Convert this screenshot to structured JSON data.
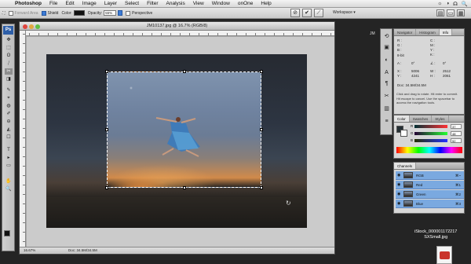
{
  "menubar": {
    "apple": "",
    "items": [
      "Photoshop",
      "File",
      "Edit",
      "Image",
      "Layer",
      "Select",
      "Filter",
      "Analysis",
      "View",
      "Window",
      "onOne",
      "Help"
    ],
    "right_icons": [
      "☼",
      "◑",
      "☊",
      "🔍"
    ]
  },
  "options": {
    "feather_label": "Forward Area",
    "shield_label": "Shield",
    "color_label": "Color:",
    "opacity_label": "Opacity:",
    "opacity_value": "55%",
    "perspective_label": "Perspective",
    "workspace_label": "Workspace ▾",
    "tb_icons": [
      "⊘",
      "✔",
      "⟋"
    ],
    "far_icons": [
      "▤",
      "▭",
      "▦"
    ]
  },
  "toolbox": {
    "badge": "Ps",
    "tools": [
      "✥",
      "⬚",
      "ʘ",
      "⧸",
      "✂",
      "◨",
      "✎",
      "⌖",
      "◍",
      "✐",
      "⊖",
      "◭",
      "☐",
      "T",
      "▸",
      "▭",
      "✋",
      "🔍"
    ]
  },
  "document": {
    "title": "JM10137.jpg @ 16.7% (RGB/8)",
    "zoom": "16.67%",
    "doc_size": "Doc: 34.5M/34.5M"
  },
  "panels": {
    "nav_tabs": [
      "Navigator",
      "Histogram",
      "Info"
    ],
    "info": {
      "r": "R :",
      "g": "G :",
      "b": "B :",
      "k": "8-bit",
      "c": "C :",
      "m": "M :",
      "y": "Y :",
      "k2": "K :",
      "bit2": "8-bit",
      "a_label": "A :",
      "a_value": "0°",
      "ang_label": "∠ :",
      "ang_value": "0°",
      "x_label": "X :",
      "x_value": "5006",
      "y_label": "Y :",
      "y_value": "4241",
      "w_label": "W :",
      "w_value": "2512",
      "h_label": "H :",
      "h_value": "2061",
      "doc": "Doc: 34.5M/34.5M",
      "hint": "Click and drag to rotate. Hit enter to commit. Hit escape to cancel. Use the spacebar to access the navigation tools."
    },
    "color_tabs": [
      "Color",
      "Swatches",
      "Styles"
    ],
    "color": {
      "r_label": "R",
      "r_value": "37",
      "g_label": "G",
      "g_value": "48",
      "b_label": "B",
      "b_value": "52"
    },
    "channels_tabs": [
      "Channels"
    ],
    "channels": [
      {
        "name": "RGB",
        "shortcut": "⌘~"
      },
      {
        "name": "Red",
        "shortcut": "⌘1"
      },
      {
        "name": "Green",
        "shortcut": "⌘2"
      },
      {
        "name": "Blue",
        "shortcut": "⌘3"
      }
    ],
    "side_icons": [
      "⟲",
      "▣",
      "◐",
      "A",
      "¶",
      "✂",
      "▥",
      "≡"
    ]
  },
  "desktop": {
    "side_label": "JM",
    "file_line1": "iStock_000001172217",
    "file_line2": "SXSmall.jpg"
  },
  "colors": {
    "selection": "#3c7bd6",
    "ps_blue": "#2e5fa8"
  }
}
